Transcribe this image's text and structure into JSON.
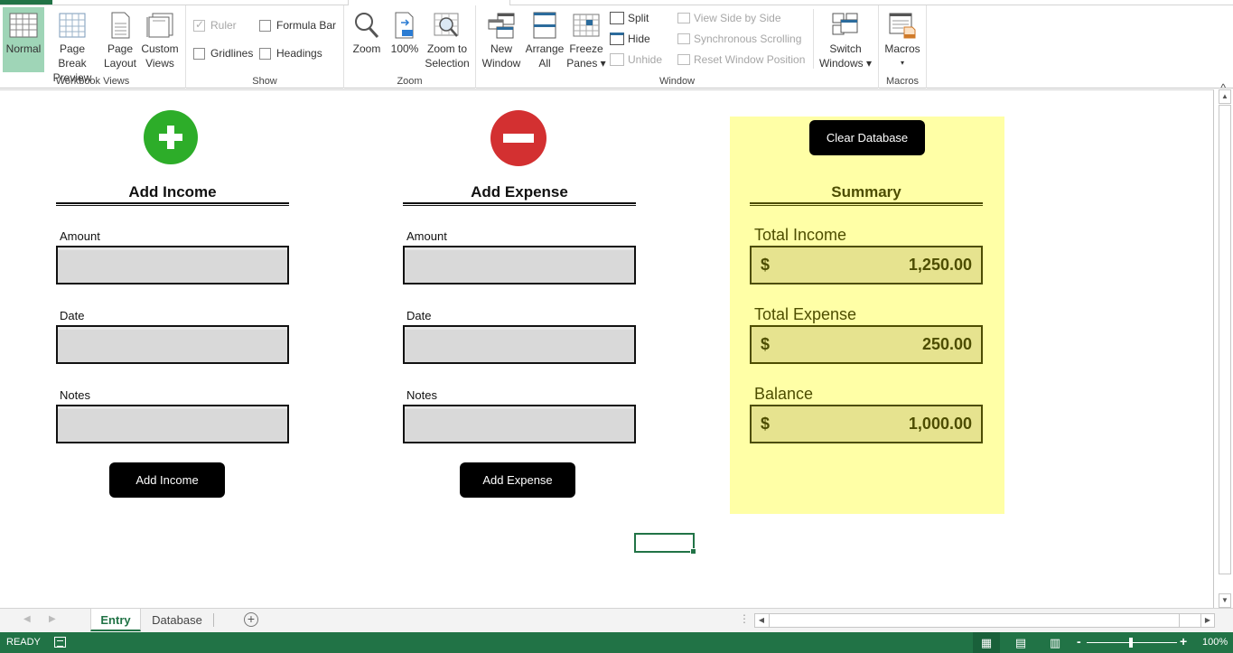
{
  "ribbon": {
    "groups": {
      "workbook_views": {
        "label": "Workbook Views",
        "buttons": [
          {
            "line1": "Normal",
            "line2": "",
            "icon": "normal-view-icon",
            "selected": true
          },
          {
            "line1": "Page Break",
            "line2": "Preview",
            "icon": "page-break-preview-icon"
          },
          {
            "line1": "Page",
            "line2": "Layout",
            "icon": "page-layout-icon"
          },
          {
            "line1": "Custom",
            "line2": "Views",
            "icon": "custom-views-icon"
          }
        ]
      },
      "show": {
        "label": "Show",
        "checkboxes": [
          {
            "label": "Ruler",
            "checked": true,
            "disabled": true
          },
          {
            "label": "Formula Bar",
            "checked": false
          },
          {
            "label": "Gridlines",
            "checked": false
          },
          {
            "label": "Headings",
            "checked": false
          }
        ]
      },
      "zoom": {
        "label": "Zoom",
        "buttons": [
          {
            "line1": "Zoom",
            "line2": "",
            "icon": "magnifier-icon"
          },
          {
            "line1": "100%",
            "line2": "",
            "icon": "zoom-100-icon"
          },
          {
            "line1": "Zoom to",
            "line2": "Selection",
            "icon": "zoom-to-selection-icon"
          }
        ]
      },
      "window": {
        "label": "Window",
        "buttons": [
          {
            "line1": "New",
            "line2": "Window",
            "icon": "new-window-icon"
          },
          {
            "line1": "Arrange",
            "line2": "All",
            "icon": "arrange-all-icon"
          },
          {
            "line1": "Freeze",
            "line2": "Panes ▾",
            "icon": "freeze-panes-icon"
          }
        ],
        "small": [
          {
            "label": "Split",
            "disabled": false
          },
          {
            "label": "Hide",
            "disabled": false
          },
          {
            "label": "Unhide",
            "disabled": true
          },
          {
            "label": "View Side by Side",
            "disabled": true
          },
          {
            "label": "Synchronous Scrolling",
            "disabled": true
          },
          {
            "label": "Reset Window Position",
            "disabled": true
          }
        ],
        "switch": {
          "line1": "Switch",
          "line2": "Windows ▾"
        }
      },
      "macros": {
        "label": "Macros",
        "button": {
          "line1": "Macros",
          "line2": "▾"
        }
      }
    },
    "collapse_glyph": "^"
  },
  "form": {
    "income": {
      "title": "Add Income",
      "fields": [
        {
          "label": "Amount",
          "value": ""
        },
        {
          "label": "Date",
          "value": ""
        },
        {
          "label": "Notes",
          "value": ""
        }
      ],
      "button": "Add Income"
    },
    "expense": {
      "title": "Add Expense",
      "fields": [
        {
          "label": "Amount",
          "value": ""
        },
        {
          "label": "Date",
          "value": ""
        },
        {
          "label": "Notes",
          "value": ""
        }
      ],
      "button": "Add Expense"
    }
  },
  "summary": {
    "clear_button": "Clear Database",
    "title": "Summary",
    "items": [
      {
        "label": "Total Income",
        "currency": "$",
        "value": "1,250.00"
      },
      {
        "label": "Total Expense",
        "currency": "$",
        "value": "250.00"
      },
      {
        "label": "Balance",
        "currency": "$",
        "value": "1,000.00"
      }
    ]
  },
  "colors": {
    "excel_green": "#217346",
    "income_icon": "#2dad29",
    "expense_icon": "#d33031",
    "summary_bg": "#ffffa6",
    "summary_box": "#e6e38f",
    "summary_text": "#4d4d00",
    "field_bg": "#d9d9d9"
  },
  "sheet_tabs": {
    "nav_prev": "◀",
    "nav_next": "▶",
    "tabs": [
      {
        "label": "Entry",
        "active": true
      },
      {
        "label": "Database",
        "active": false
      }
    ],
    "add_glyph": "+"
  },
  "scroll": {
    "up": "▲",
    "down": "▼",
    "left": "◀",
    "right": "▶",
    "split": "⋮"
  },
  "status": {
    "mode": "READY",
    "zoom_minus": "-",
    "zoom_plus": "+",
    "zoom": "100%",
    "view_normal_glyph": "▦",
    "view_layout_glyph": "▤",
    "view_pagebreak_glyph": "▥"
  }
}
